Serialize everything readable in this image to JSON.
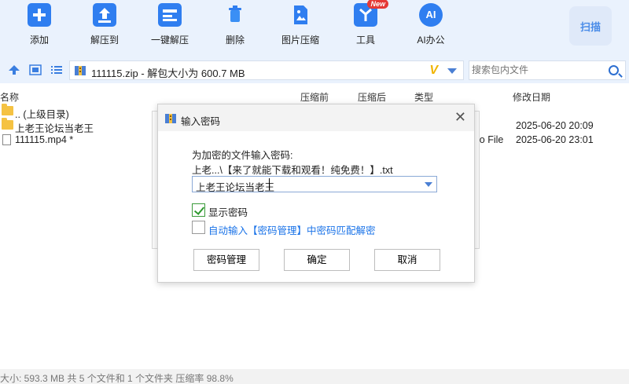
{
  "toolbar": {
    "items": [
      {
        "label": "添加",
        "icon": "add-icon"
      },
      {
        "label": "解压到",
        "icon": "extract-to-icon"
      },
      {
        "label": "一键解压",
        "icon": "one-click-extract-icon"
      },
      {
        "label": "删除",
        "icon": "delete-icon"
      },
      {
        "label": "图片压缩",
        "icon": "image-compress-icon"
      },
      {
        "label": "工具",
        "icon": "tools-icon",
        "badge": "New"
      },
      {
        "label": "AI办公",
        "icon": "ai-office-icon",
        "glyph": "AI"
      }
    ],
    "scan_label": "扫描"
  },
  "pathbar": {
    "path_text": "111115.zip - 解包大小为 600.7 MB",
    "logo": "V",
    "search_placeholder": "搜索包内文件"
  },
  "columns": {
    "name": "名称",
    "compressed": "压缩前",
    "after": "压缩后",
    "type": "类型",
    "modified": "修改日期"
  },
  "files": [
    {
      "name": ".. (上级目录)",
      "kind": "folder",
      "type": "",
      "date": ""
    },
    {
      "name": "上老王论坛当老王",
      "kind": "folder",
      "type": "",
      "date": "2025-06-20 20:09"
    },
    {
      "name": "111115.mp4 *",
      "kind": "file",
      "type": "io File",
      "date": "2025-06-20 23:01"
    }
  ],
  "dialog": {
    "title": "输入密码",
    "prompt": "为加密的文件输入密码:",
    "filename": "上老...\\【来了就能下载和观看！纯免费！】.txt",
    "password_value": "上老王论坛当老王",
    "show_password_label": "显示密码",
    "show_password_checked": true,
    "auto_input_label": "自动输入【密码管理】中密码匹配解密",
    "auto_input_checked": false,
    "buttons": {
      "manage": "密码管理",
      "ok": "确定",
      "cancel": "取消"
    }
  },
  "status": {
    "text": "大小: 593.3 MB 共 5 个文件和 1 个文件夹 压缩率 98.8%"
  },
  "colors": {
    "toolbar_bg": "#eaf2fd",
    "icon_blue": "#2f7ef0",
    "link_blue": "#1a73e8",
    "check_green": "#2e9a2e",
    "badge_red": "#e53935"
  }
}
